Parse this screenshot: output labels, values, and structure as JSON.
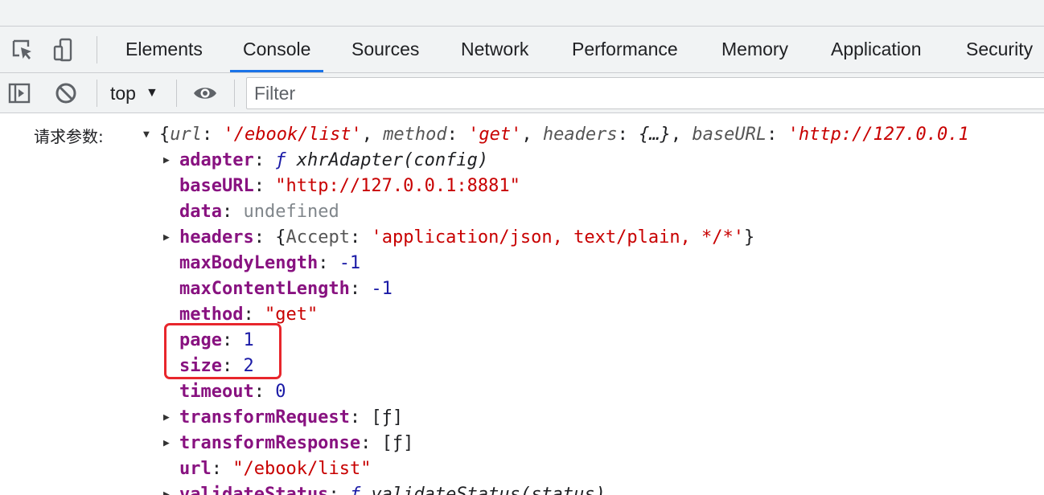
{
  "tabs": {
    "elements": "Elements",
    "console": "Console",
    "sources": "Sources",
    "network": "Network",
    "performance": "Performance",
    "memory": "Memory",
    "application": "Application",
    "security": "Security",
    "active": "Console"
  },
  "toolbar": {
    "context": "top",
    "filter_placeholder": "Filter"
  },
  "log": {
    "label": "请求参数:",
    "summary": {
      "open": "{",
      "url_key": "url",
      "url_val": "'/ebook/list'",
      "method_key": "method",
      "method_val": "'get'",
      "headers_key": "headers",
      "headers_val": "{…}",
      "baseURL_key": "baseURL",
      "baseURL_val": "'http://127.0.0.1"
    },
    "props": {
      "adapter": {
        "key": "adapter",
        "f": "ƒ",
        "sig": "xhrAdapter(config)"
      },
      "baseURL": {
        "key": "baseURL",
        "value": "\"http://127.0.0.1:8881\""
      },
      "data": {
        "key": "data",
        "value": "undefined"
      },
      "headers": {
        "key": "headers",
        "open": "{",
        "sub_key": "Accept",
        "sub_val": "'application/json, text/plain, */*'",
        "close": "}"
      },
      "maxBodyLength": {
        "key": "maxBodyLength",
        "value": "-1"
      },
      "maxContentLength": {
        "key": "maxContentLength",
        "value": "-1"
      },
      "method": {
        "key": "method",
        "value": "\"get\""
      },
      "page": {
        "key": "page",
        "value": "1"
      },
      "size": {
        "key": "size",
        "value": "2"
      },
      "timeout": {
        "key": "timeout",
        "value": "0"
      },
      "transformRequest": {
        "key": "transformRequest",
        "value": "[ƒ]"
      },
      "transformResponse": {
        "key": "transformResponse",
        "value": "[ƒ]"
      },
      "url": {
        "key": "url",
        "value": "\"/ebook/list\""
      },
      "validateStatus": {
        "key": "validateStatus",
        "f": "ƒ",
        "sig": "validateStatus(status)"
      }
    }
  },
  "colors": {
    "key": "#881280",
    "string": "#c80000",
    "number": "#1a1aa6",
    "highlight": "#e8262c",
    "active_tab_underline": "#1a73e8"
  },
  "icons": {
    "inspect": "inspect-element-icon",
    "device": "device-toolbar-icon",
    "sidebar": "console-sidebar-icon",
    "clear": "clear-console-icon",
    "eye": "live-expression-eye-icon"
  }
}
